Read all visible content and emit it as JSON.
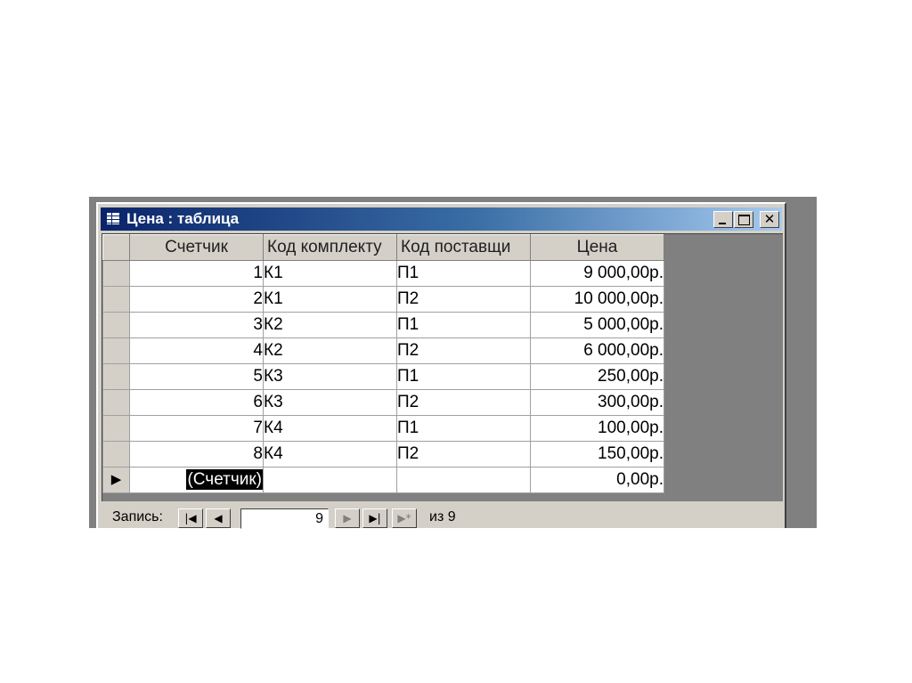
{
  "window": {
    "title": "Цена : таблица",
    "icon": "table-icon"
  },
  "table": {
    "columns": [
      "Счетчик",
      "Код комплекту",
      "Код поставщи",
      "Цена"
    ],
    "rows": [
      {
        "counter": "1",
        "kit": "К1",
        "supplier": "П1",
        "price": "9 000,00р."
      },
      {
        "counter": "2",
        "kit": "К1",
        "supplier": "П2",
        "price": "10 000,00р."
      },
      {
        "counter": "3",
        "kit": "К2",
        "supplier": "П1",
        "price": "5 000,00р."
      },
      {
        "counter": "4",
        "kit": "К2",
        "supplier": "П2",
        "price": "6 000,00р."
      },
      {
        "counter": "5",
        "kit": "К3",
        "supplier": "П1",
        "price": "250,00р."
      },
      {
        "counter": "6",
        "kit": "К3",
        "supplier": "П2",
        "price": "300,00р."
      },
      {
        "counter": "7",
        "kit": "К4",
        "supplier": "П1",
        "price": "100,00р."
      },
      {
        "counter": "8",
        "kit": "К4",
        "supplier": "П2",
        "price": "150,00р."
      }
    ],
    "new_row": {
      "counter": "(Счетчик)",
      "kit": "",
      "supplier": "",
      "price": "0,00р.",
      "selector_glyph": "▶"
    }
  },
  "navigation": {
    "label": "Запись:",
    "current_record": "9",
    "of_text": "из 9",
    "buttons": {
      "first": "|◀",
      "prev": "◀",
      "next": "▶",
      "last": "▶|",
      "new": "▶*"
    }
  },
  "colors": {
    "titlebar_start": "#0a246a",
    "titlebar_end": "#a6caf0",
    "chrome": "#d4d0c8"
  }
}
